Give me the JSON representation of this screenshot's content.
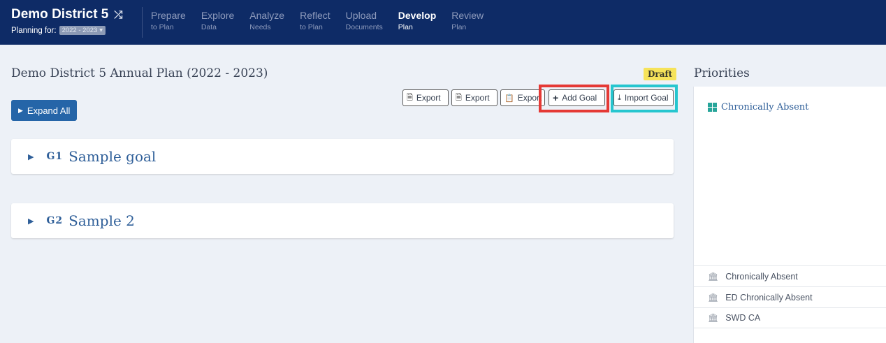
{
  "header": {
    "district_name": "Demo District 5",
    "shuffle_icon": "shuffle-icon",
    "planning_label": "Planning for:",
    "year_value": "2022 - 2023",
    "nav": [
      {
        "main": "Prepare",
        "sub": "to Plan",
        "active": false
      },
      {
        "main": "Explore",
        "sub": "Data",
        "active": false
      },
      {
        "main": "Analyze",
        "sub": "Needs",
        "active": false
      },
      {
        "main": "Reflect",
        "sub": "to Plan",
        "active": false
      },
      {
        "main": "Upload",
        "sub": "Documents",
        "active": false
      },
      {
        "main": "Develop",
        "sub": "Plan",
        "active": true
      },
      {
        "main": "Review",
        "sub": "Plan",
        "active": false
      }
    ]
  },
  "main": {
    "plan_title": "Demo District 5 Annual Plan (2022 - 2023)",
    "status_badge": "Draft",
    "expand_all_label": "Expand All",
    "toolbar": {
      "export_1": "Export",
      "export_2": "Export",
      "export_3": "Export",
      "add_goal": "Add Goal",
      "import_goal": "Import Goal"
    },
    "goals": [
      {
        "code": "G1",
        "name": "Sample goal"
      },
      {
        "code": "G2",
        "name": "Sample 2"
      }
    ]
  },
  "priorities": {
    "title": "Priorities",
    "primary": "Chronically Absent",
    "items": [
      "Chronically Absent",
      "ED Chronically Absent",
      "SWD CA"
    ]
  },
  "colors": {
    "nav_bg": "#0e2b66",
    "accent": "#2565a8",
    "draft_badge": "#f6e35a",
    "highlight_red": "#e53935",
    "highlight_cyan": "#26c6cf"
  }
}
